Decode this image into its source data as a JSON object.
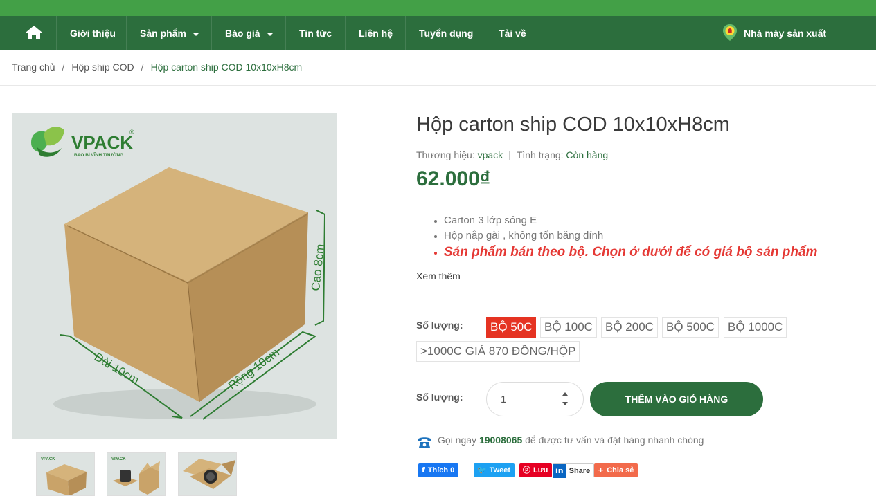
{
  "nav": {
    "items": [
      {
        "label": "Giới thiệu",
        "dropdown": false
      },
      {
        "label": "Sản phẩm",
        "dropdown": true
      },
      {
        "label": "Báo giá",
        "dropdown": true
      },
      {
        "label": "Tin tức",
        "dropdown": false
      },
      {
        "label": "Liên hệ",
        "dropdown": false
      },
      {
        "label": "Tuyển dụng",
        "dropdown": false
      },
      {
        "label": "Tải về",
        "dropdown": false
      }
    ],
    "factory_label": "Nhà máy sản xuất"
  },
  "breadcrumb": {
    "home": "Trang chủ",
    "separator": "/",
    "category": "Hộp ship COD",
    "current": "Hộp carton ship COD 10x10xH8cm"
  },
  "image": {
    "brand": "VPACK",
    "brand_sub": "BAO BÌ VĨNH TRƯỜNG",
    "dim_length": "Dài 10cm",
    "dim_width": "Rộng 10cm",
    "dim_height": "Cao 8cm"
  },
  "product": {
    "title": "Hộp carton ship COD 10x10xH8cm",
    "brand_label": "Thương hiệu:",
    "brand_value": "vpack",
    "status_label": "Tình trạng:",
    "status_value": "Còn hàng",
    "price": "62.000₫",
    "features": [
      "Carton 3 lớp sóng E",
      "Hộp nắp gài , không tốn băng dính",
      "Sản phẩm bán theo bộ. Chọn ở dưới để có giá bộ sản phẩm"
    ],
    "more_label": "Xem thêm"
  },
  "variants": {
    "label": "Số lượng:",
    "options": [
      "BỘ 50C",
      "BỘ 100C",
      "BỘ 200C",
      "BỘ 500C",
      "BỘ 1000C",
      ">1000C GIÁ 870 ĐỒNG/HỘP"
    ],
    "selected": "BỘ 50C"
  },
  "quantity": {
    "label": "Số lượng:",
    "value": "1"
  },
  "cart_button": "THÊM VÀO GIỎ HÀNG",
  "hotline": {
    "prefix": "Gọi ngay",
    "number": "19008065",
    "suffix": "để được tư vấn và đặt hàng nhanh chóng"
  },
  "share": {
    "facebook": "Thích 0",
    "twitter": "Tweet",
    "pinterest": "Lưu",
    "linkedin": "Share",
    "addthis": "Chia sẻ"
  },
  "colors": {
    "primary": "#2c6e3d",
    "topbar": "#43a047",
    "accent_red": "#e53322"
  }
}
